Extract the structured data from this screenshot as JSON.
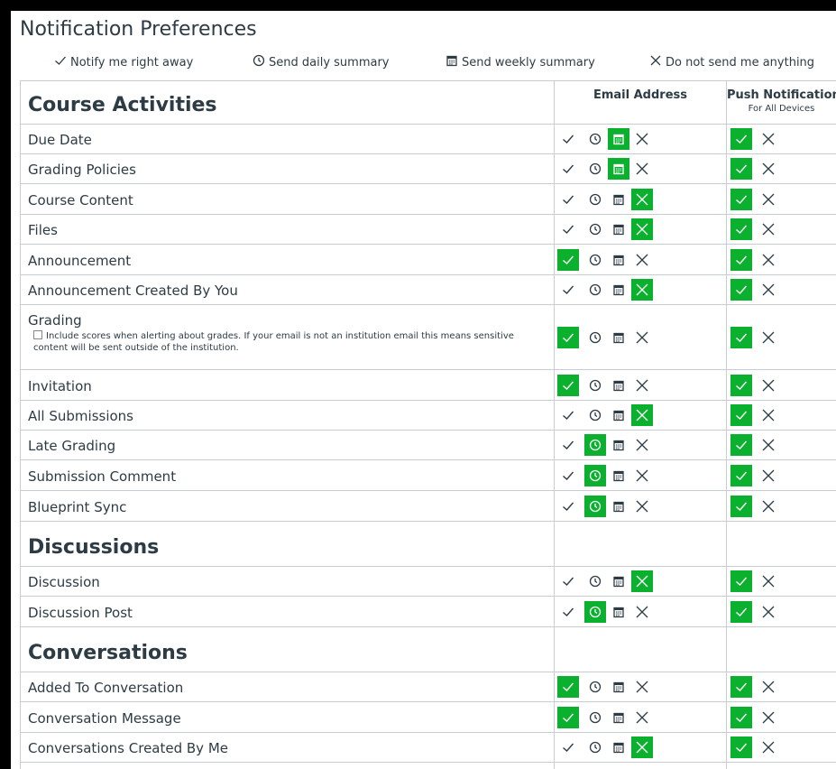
{
  "page_title": "Notification Preferences",
  "legend": [
    {
      "icon": "check-icon",
      "label": "Notify me right away"
    },
    {
      "icon": "clock-icon",
      "label": "Send daily summary"
    },
    {
      "icon": "calendar-icon",
      "label": "Send weekly summary"
    },
    {
      "icon": "x-icon",
      "label": "Do not send me anything"
    }
  ],
  "columns": {
    "email": "Email Address",
    "push": "Push Notification",
    "push_sub": "For All Devices"
  },
  "colors": {
    "selected": "#0ab02e",
    "text": "#2d3b45",
    "border": "#c7cdd1"
  },
  "sections": [
    {
      "title": "Course Activities",
      "rows": [
        {
          "label": "Due Date",
          "email": "weekly",
          "push": "on"
        },
        {
          "label": "Grading Policies",
          "email": "weekly",
          "push": "on"
        },
        {
          "label": "Course Content",
          "email": "never",
          "push": "on"
        },
        {
          "label": "Files",
          "email": "never",
          "push": "on"
        },
        {
          "label": "Announcement",
          "email": "immediately",
          "push": "on"
        },
        {
          "label": "Announcement Created By You",
          "email": "never",
          "push": "on"
        },
        {
          "label": "Grading",
          "email": "immediately",
          "push": "on",
          "note": "Include scores when alerting about grades. If your email is not an institution email this means sensitive content will be sent outside of the institution.",
          "note_checked": false
        },
        {
          "label": "Invitation",
          "email": "immediately",
          "push": "on"
        },
        {
          "label": "All Submissions",
          "email": "never",
          "push": "on"
        },
        {
          "label": "Late Grading",
          "email": "daily",
          "push": "on"
        },
        {
          "label": "Submission Comment",
          "email": "daily",
          "push": "on"
        },
        {
          "label": "Blueprint Sync",
          "email": "daily",
          "push": "on"
        }
      ]
    },
    {
      "title": "Discussions",
      "rows": [
        {
          "label": "Discussion",
          "email": "never",
          "push": "on"
        },
        {
          "label": "Discussion Post",
          "email": "daily",
          "push": "on"
        }
      ]
    },
    {
      "title": "Conversations",
      "rows": [
        {
          "label": "Added To Conversation",
          "email": "immediately",
          "push": "on"
        },
        {
          "label": "Conversation Message",
          "email": "immediately",
          "push": "on"
        },
        {
          "label": "Conversations Created By Me",
          "email": "never",
          "push": "on"
        }
      ]
    }
  ]
}
